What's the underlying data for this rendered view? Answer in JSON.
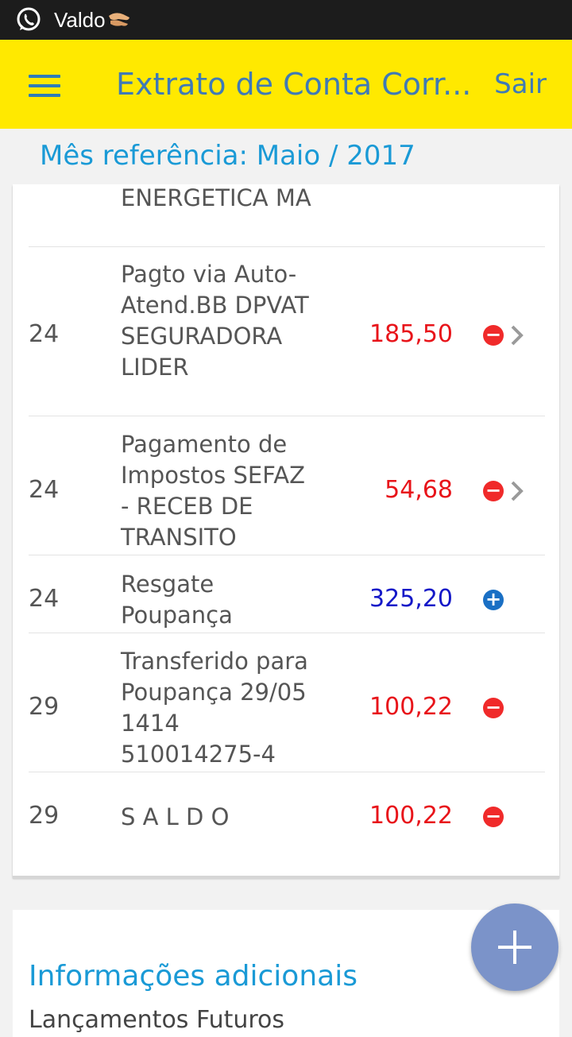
{
  "status_bar": {
    "notification_text": "Valdo"
  },
  "app_bar": {
    "title": "Extrato de Conta Corr...",
    "logout_label": "Sair"
  },
  "reference_month": "Mês referência: Maio / 2017",
  "transactions": [
    {
      "day": "",
      "description": "ENERGETICA MA",
      "amount": "",
      "type": ""
    },
    {
      "day": "24",
      "description": "Pagto via Auto-Atend.BB DPVAT SEGURADORA LIDER",
      "amount": "185,50",
      "type": "debit",
      "has_detail": true
    },
    {
      "day": "24",
      "description": "Pagamento de Impostos SEFAZ - RECEB DE TRANSITO",
      "amount": "54,68",
      "type": "debit",
      "has_detail": true
    },
    {
      "day": "24",
      "description": "Resgate Poupança",
      "amount": "325,20",
      "type": "credit",
      "has_detail": false
    },
    {
      "day": "29",
      "description": "Transferido para Poupança 29/05 1414 510014275-4",
      "amount": "100,22",
      "type": "debit",
      "has_detail": false
    },
    {
      "day": "29",
      "description": "S A L D O",
      "amount": "100,22",
      "type": "debit",
      "has_detail": false
    }
  ],
  "additional_info": {
    "title": "Informações adicionais",
    "subtitle": "Lançamentos Futuros"
  },
  "icons": {
    "status": "whatsapp-icon",
    "menu": "hamburger-menu-icon",
    "debit": "minus-circle-icon",
    "credit": "plus-circle-icon",
    "detail": "chevron-right-icon",
    "fab": "plus-icon"
  },
  "colors": {
    "app_bar": "#ffe900",
    "title": "#3f7ab6",
    "accent": "#1a9ad6",
    "debit": "#e8141a",
    "credit": "#1418c8",
    "fab": "#7b93c9"
  }
}
